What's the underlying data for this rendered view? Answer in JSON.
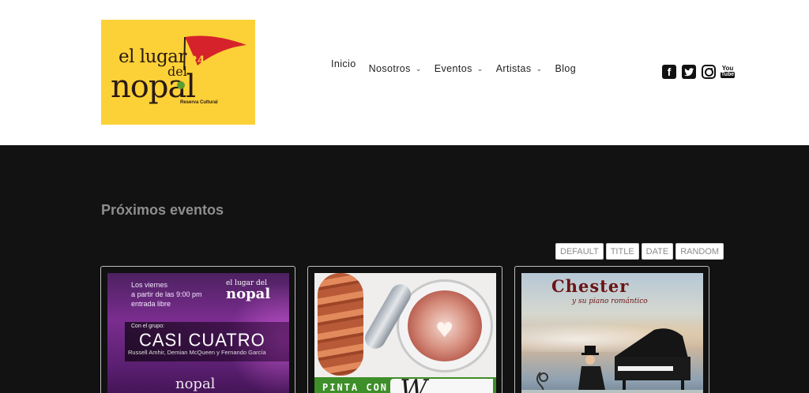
{
  "brand": {
    "logo_line1": "el lugar",
    "logo_line2": "del",
    "logo_line3": "nopal",
    "logo_tagline": "Reserva Cultural",
    "logo_badge": "24 años",
    "bg_color": "#fcd138"
  },
  "nav": {
    "items": [
      {
        "label": "Inicio",
        "has_dropdown": false,
        "active": true
      },
      {
        "label": "Nosotros",
        "has_dropdown": true
      },
      {
        "label": "Eventos",
        "has_dropdown": true
      },
      {
        "label": "Artistas",
        "has_dropdown": true
      },
      {
        "label": "Blog",
        "has_dropdown": false
      }
    ],
    "chevron": "⌄"
  },
  "social": {
    "facebook": "f",
    "youtube_top": "You",
    "youtube_bottom": "Tube",
    "icons": [
      "facebook-icon",
      "twitter-icon",
      "instagram-icon",
      "youtube-icon"
    ]
  },
  "events": {
    "section_title": "Próximos eventos",
    "sort_buttons": [
      "DEFAULT",
      "TITLE",
      "DATE",
      "RANDOM"
    ],
    "cards": [
      {
        "poster_line1": "Los viernes",
        "poster_line2": "a partir de las 9:00 pm",
        "poster_line3": "entrada libre",
        "poster_group_label": "Con el grupo:",
        "poster_title": "CASI CUATRO",
        "poster_names": "Russell Amhir, Demian McQueen y Fernando García",
        "poster_logo_small": "el lugar del",
        "poster_logo_big": "nopal",
        "poster_logo_bottom": "nopal"
      },
      {
        "poster_banner": "PINTA CON",
        "poster_script": "W"
      },
      {
        "poster_title": "Chester",
        "poster_subtitle": "y su piano romántico"
      }
    ]
  },
  "colors": {
    "page_bg": "#121212",
    "header_bg": "#ffffff",
    "section_title": "#8e8e8e"
  }
}
